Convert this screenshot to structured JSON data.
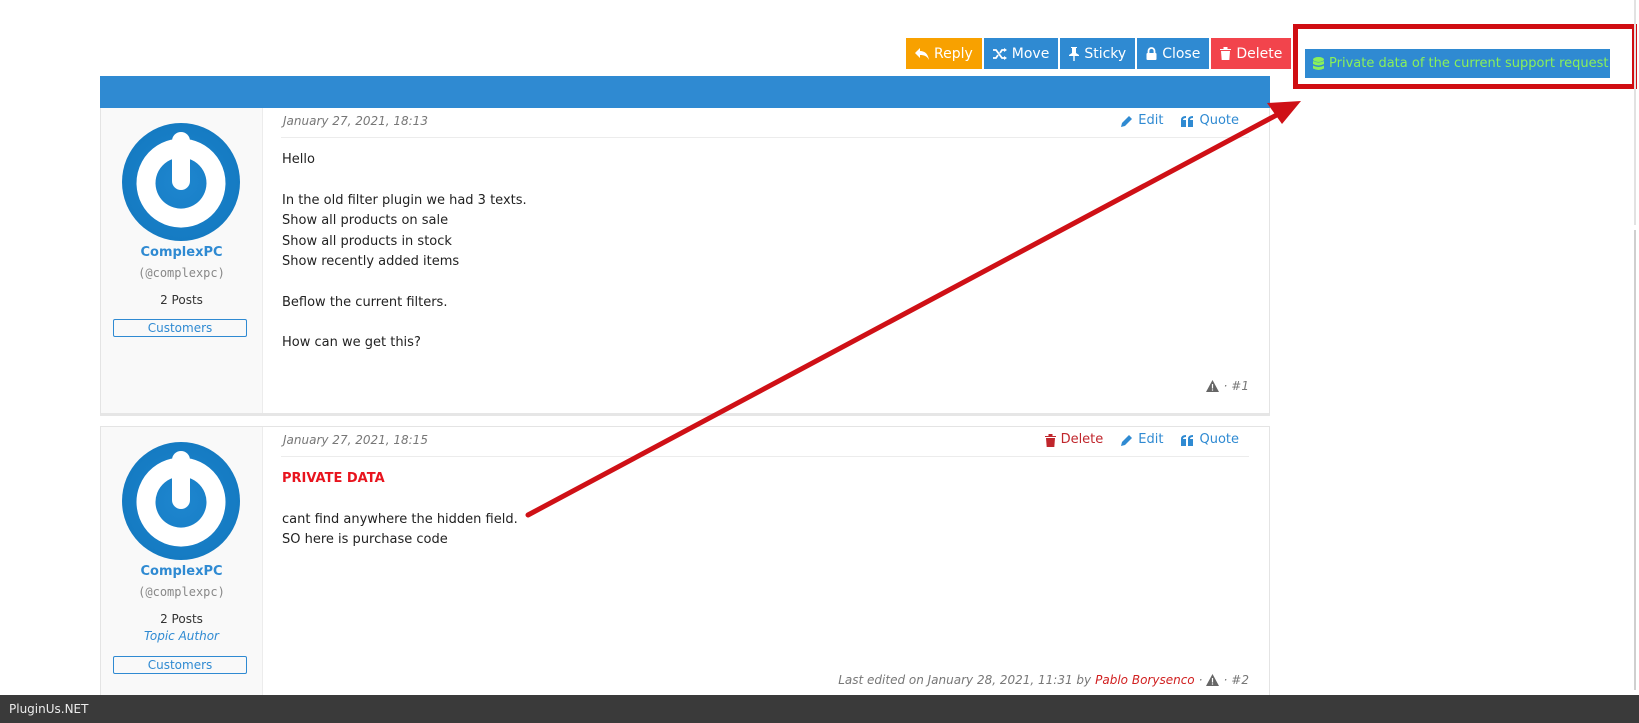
{
  "toolbar": {
    "reply": "Reply",
    "move": "Move",
    "sticky": "Sticky",
    "close": "Close",
    "delete": "Delete"
  },
  "private_button": {
    "label": "Private data of the current support request"
  },
  "colors": {
    "accent": "#2f8ad2",
    "reply": "#f8a100",
    "delete": "#f2444c",
    "highlight": "#d00d12",
    "private_text": "#8af05a"
  },
  "posts": [
    {
      "date": "January 27, 2021, 18:13",
      "actions": {
        "edit": "Edit",
        "quote": "Quote"
      },
      "author": {
        "name": "ComplexPC",
        "handle": "(@complexpc)",
        "posts": "2 Posts",
        "role": "Customers"
      },
      "lines": [
        "Hello",
        "In the old filter plugin we had 3 texts.",
        "Show all products on sale",
        "Show all products in stock",
        "Show recently added items",
        "Beflow the current filters.",
        "How can we get this?"
      ],
      "number": "#1"
    },
    {
      "date": "January 27, 2021, 18:15",
      "actions": {
        "delete": "Delete",
        "edit": "Edit",
        "quote": "Quote"
      },
      "author": {
        "name": "ComplexPC",
        "handle": "(@complexpc)",
        "posts": "2 Posts",
        "topic_author": "Topic Author",
        "role": "Customers"
      },
      "private_title": "PRIVATE DATA",
      "lines": [
        "cant find anywhere the hidden field.",
        "SO here is purchase code"
      ],
      "last_edited": "Last edited on January 28, 2021, 11:31 by",
      "editor": "Pablo Borysenco",
      "number": "#2"
    }
  ],
  "statusbar": {
    "text": "PluginUs.NET"
  }
}
